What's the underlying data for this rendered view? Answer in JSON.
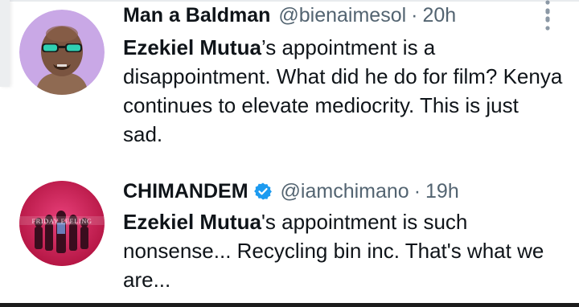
{
  "tweets": [
    {
      "name": "Man a Baldman",
      "handle": "@bienaimesol",
      "separator": "·",
      "time": "20h",
      "mention": "Ezekiel Mutua",
      "text": "’s appointment is a disappointment. What did he do for film? Kenya continues to elevate mediocrity. This is just sad.",
      "verified": false,
      "avatar_icon": "cartoon-bald-man-avatar"
    },
    {
      "name": "CHIMANDEM",
      "handle": "@iamchimano",
      "separator": "·",
      "time": "19h",
      "mention": "Ezekiel Mutua",
      "text": "'s appointment is such nonsense... Recycling bin inc. That's what we are...",
      "verified": true,
      "avatar_icon": "friday-feeling-group-photo-avatar",
      "avatar_text": "FRIDAY FEELING"
    }
  ],
  "colors": {
    "text": "#0f1419",
    "secondary": "#536471",
    "verified_blue": "#1d9bf0",
    "avatar1_bg": "#c9a8e6",
    "avatar2_bg": "#d8245e"
  },
  "icons": {
    "more": "more-vertical-icon",
    "verified": "verified-badge-icon"
  }
}
